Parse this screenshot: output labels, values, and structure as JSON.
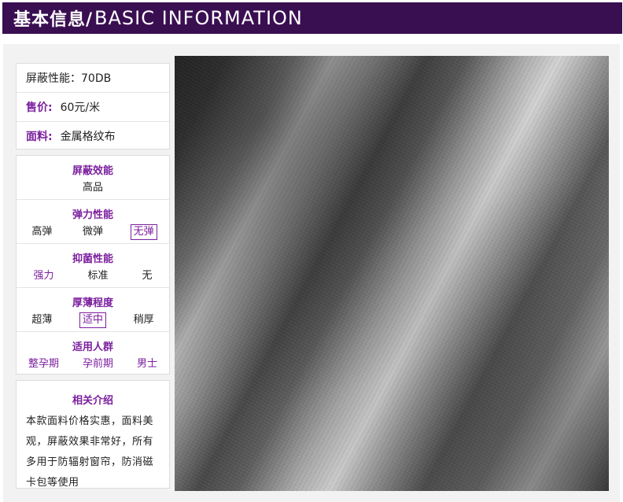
{
  "header": {
    "title_cn": "基本信息/",
    "title_en": "BASIC INFORMATION"
  },
  "info": {
    "shielding": "屏蔽性能：70DB",
    "price_label": "售价:",
    "price_value": "60元/米",
    "material_label": "面料:",
    "material_value": "金属格纹布"
  },
  "attributes": [
    {
      "title": "屏蔽效能",
      "options": [
        "高品"
      ]
    },
    {
      "title": "弹力性能",
      "options": [
        "高弹",
        "微弹",
        "无弹"
      ],
      "selected": "无弹"
    },
    {
      "title": "抑菌性能",
      "options": [
        "强力",
        "标准",
        "无"
      ],
      "highlighted": "强力"
    },
    {
      "title": "厚薄程度",
      "options": [
        "超薄",
        "适中",
        "稍厚"
      ],
      "selected": "适中"
    },
    {
      "title": "适用人群",
      "options": [
        "整孕期",
        "孕前期",
        "男士"
      ],
      "all_highlighted": true
    }
  ],
  "description": {
    "title": "相关介绍",
    "text": "本款面料价格实惠，面料美观，屏蔽效果非常好，所有多用于防辐射窗帘，防消磁卡包等使用"
  },
  "colors": {
    "header_bg": "#3a0f52",
    "accent": "#7b1f9e"
  }
}
